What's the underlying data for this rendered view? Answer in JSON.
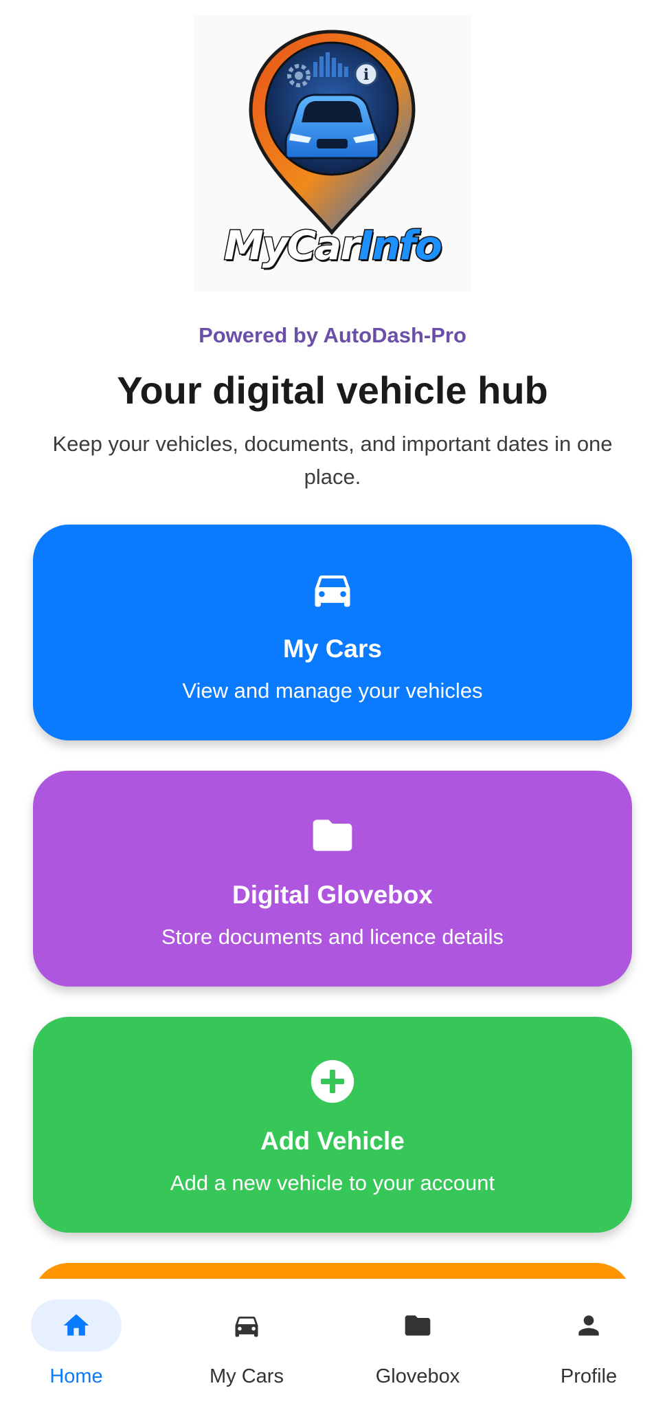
{
  "logo": {
    "text_part1": "MyCar",
    "text_part2": "Info"
  },
  "header": {
    "powered_by": "Powered by AutoDash-Pro",
    "title": "Your digital vehicle hub",
    "subtitle": "Keep your vehicles, documents, and important dates in one place."
  },
  "cards": [
    {
      "title": "My Cars",
      "description": "View and manage your vehicles",
      "icon": "car-icon",
      "color": "#0a7bff"
    },
    {
      "title": "Digital Glovebox",
      "description": "Store documents and licence details",
      "icon": "folder-icon",
      "color": "#af56de"
    },
    {
      "title": "Add Vehicle",
      "description": "Add a new vehicle to your account",
      "icon": "plus-circle-icon",
      "color": "#37c759"
    }
  ],
  "partial_card_color": "#ff9500",
  "bottom_nav": {
    "active": "Home",
    "items": [
      {
        "label": "Home",
        "icon": "home-icon"
      },
      {
        "label": "My Cars",
        "icon": "car-icon"
      },
      {
        "label": "Glovebox",
        "icon": "folder-icon"
      },
      {
        "label": "Profile",
        "icon": "person-icon"
      }
    ]
  },
  "colors": {
    "accent": "#0a7bff",
    "powered_by": "#6b4ea8",
    "nav_active_bg": "#e6f0ff"
  }
}
